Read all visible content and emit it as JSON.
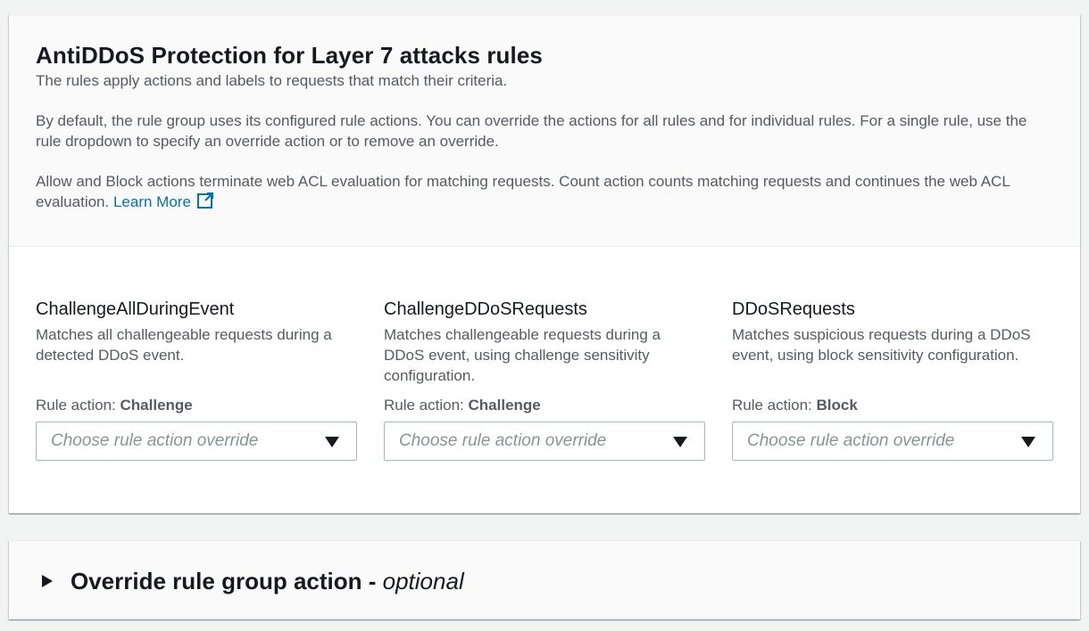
{
  "header": {
    "title": "AntiDDoS Protection for Layer 7 attacks rules",
    "description_1": "The rules apply actions and labels to requests that match their criteria.",
    "description_2": "By default, the rule group uses its configured rule actions. You can override the actions for all rules and for individual rules. For a single rule, use the rule dropdown to specify an override action or to remove an override.",
    "description_3": "Allow and Block actions terminate web ACL evaluation for matching requests. Count action counts matching requests and continues the web ACL evaluation.",
    "learn_more": "Learn More",
    "learn_more_icon": "external-link-icon"
  },
  "rules": [
    {
      "name": "ChallengeAllDuringEvent",
      "description": "Matches all challengeable requests during a detected DDoS event.",
      "action_label": "Rule action:",
      "action_value": "Challenge",
      "select_placeholder": "Choose rule action override"
    },
    {
      "name": "ChallengeDDoSRequests",
      "description": "Matches challengeable requests during a DDoS event, using challenge sensitivity configuration.",
      "action_label": "Rule action:",
      "action_value": "Challenge",
      "select_placeholder": "Choose rule action override"
    },
    {
      "name": "DDoSRequests",
      "description": "Matches suspicious requests during a DDoS event, using block sensitivity configuration.",
      "action_label": "Rule action:",
      "action_value": "Block",
      "select_placeholder": "Choose rule action override"
    }
  ],
  "override_section": {
    "title": "Override rule group action -",
    "optional": "optional",
    "expand_icon": "caret-right-icon"
  },
  "colors": {
    "link": "#0073bb",
    "text_primary": "#16191f",
    "text_secondary": "#545b64",
    "placeholder": "#879596",
    "border": "#aab7b8"
  }
}
